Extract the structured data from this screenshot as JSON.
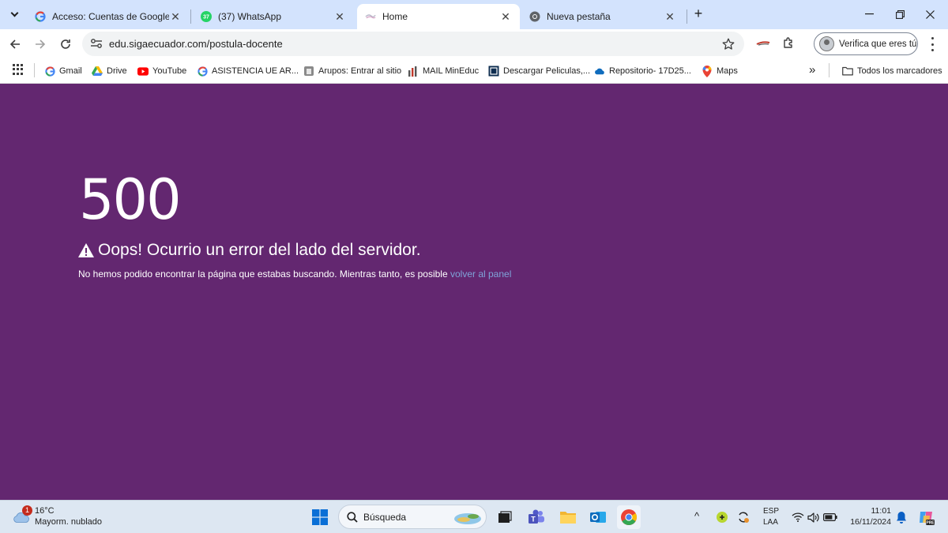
{
  "browser": {
    "tabs": [
      {
        "title": "Acceso: Cuentas de Google",
        "favicon": "google-icon"
      },
      {
        "title": "(37) WhatsApp",
        "favicon": "whatsapp-icon",
        "badge": "37"
      },
      {
        "title": "Home",
        "favicon": "site-icon",
        "active": true
      },
      {
        "title": "Nueva pestaña",
        "favicon": "chrome-icon"
      }
    ],
    "close_glyph": "✕",
    "new_tab_glyph": "+",
    "url": "edu.sigaecuador.com/postula-docente",
    "profile_label": "Verifica que eres tú"
  },
  "bookmarks": {
    "items": [
      {
        "label": "Gmail",
        "icon": "google-icon"
      },
      {
        "label": "Drive",
        "icon": "drive-icon"
      },
      {
        "label": "YouTube",
        "icon": "youtube-icon"
      },
      {
        "label": "ASISTENCIA UE AR...",
        "icon": "google-icon"
      },
      {
        "label": "Arupos: Entrar al sitio",
        "icon": "arupos-icon"
      },
      {
        "label": "MAIL MinEduc",
        "icon": "chart-icon"
      },
      {
        "label": "Descargar Peliculas,...",
        "icon": "film-icon"
      },
      {
        "label": "Repositorio- 17D25...",
        "icon": "onedrive-icon"
      },
      {
        "label": "Maps",
        "icon": "maps-icon"
      }
    ],
    "overflow": "»",
    "all_bookmarks": "Todos los marcadores"
  },
  "page": {
    "error_code": "500",
    "error_title": "Oops! Ocurrio un error del lado del servidor.",
    "error_text": "No hemos podido encontrar la página que estabas buscando. Mientras tanto, es posible",
    "link_text": "volver al panel",
    "background_color": "#632770",
    "link_color": "#7fa3d9"
  },
  "taskbar": {
    "weather_temp": "16°C",
    "weather_cond": "Mayorm. nublado",
    "weather_badge": "1",
    "search_label": "Búsqueda",
    "lang_top": "ESP",
    "lang_bottom": "LAA",
    "time": "11:01",
    "date": "16/11/2024",
    "tray_chevron": "^"
  }
}
